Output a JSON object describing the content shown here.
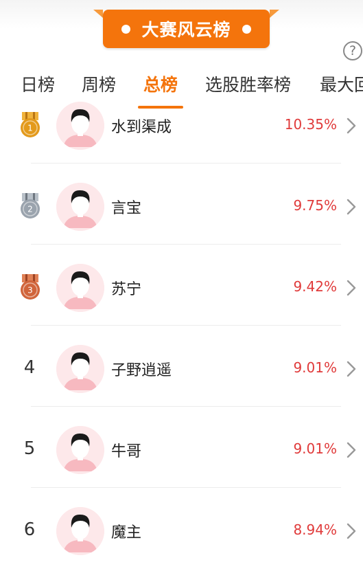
{
  "banner": {
    "title": "大赛风云榜"
  },
  "help": {
    "symbol": "?"
  },
  "tabs": [
    {
      "label": "日榜",
      "active": false
    },
    {
      "label": "周榜",
      "active": false
    },
    {
      "label": "总榜",
      "active": true
    },
    {
      "label": "选股胜率榜",
      "active": false
    },
    {
      "label": "最大回",
      "active": false
    }
  ],
  "ranking": [
    {
      "rank": "1",
      "name": "水到渠成",
      "rate": "10.35%",
      "medal": "gold"
    },
    {
      "rank": "2",
      "name": "言宝",
      "rate": "9.75%",
      "medal": "silver"
    },
    {
      "rank": "3",
      "name": "苏宁",
      "rate": "9.42%",
      "medal": "bronze"
    },
    {
      "rank": "4",
      "name": "子野逍遥",
      "rate": "9.01%",
      "medal": ""
    },
    {
      "rank": "5",
      "name": "牛哥",
      "rate": "9.01%",
      "medal": ""
    },
    {
      "rank": "6",
      "name": "魔主",
      "rate": "8.94%",
      "medal": ""
    }
  ],
  "colors": {
    "accent": "#f4740c",
    "rate": "#e03a3a",
    "gold": "#e39a1c",
    "silver": "#9aa3ad",
    "bronze": "#d0643a"
  }
}
